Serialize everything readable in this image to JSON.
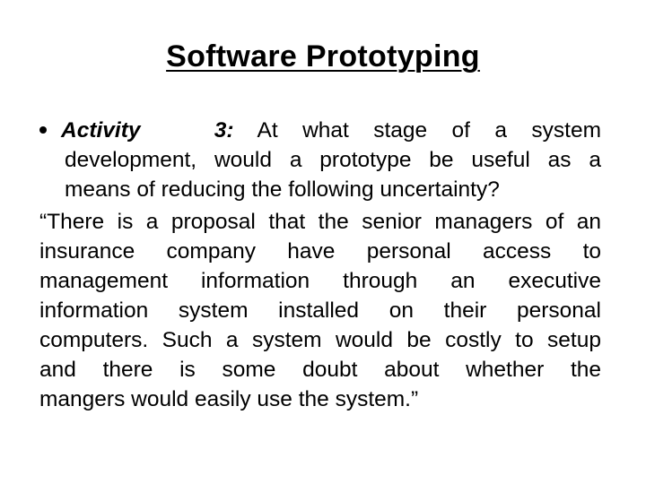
{
  "slide": {
    "title": "Software Prototyping",
    "bullet": {
      "label": "Activity",
      "number": "3:",
      "lines": [
        "At what stage of a system",
        "development, would a prototype be useful as a",
        "means of reducing the following uncertainty?"
      ]
    },
    "quote_lines": [
      "“There is a proposal that the senior managers of an",
      "insurance company have personal access to",
      "management information through an executive",
      "information system installed on their personal",
      "computers. Such a system would be costly to setup",
      "and there is some doubt about whether the",
      "mangers would easily use the system.”"
    ]
  }
}
